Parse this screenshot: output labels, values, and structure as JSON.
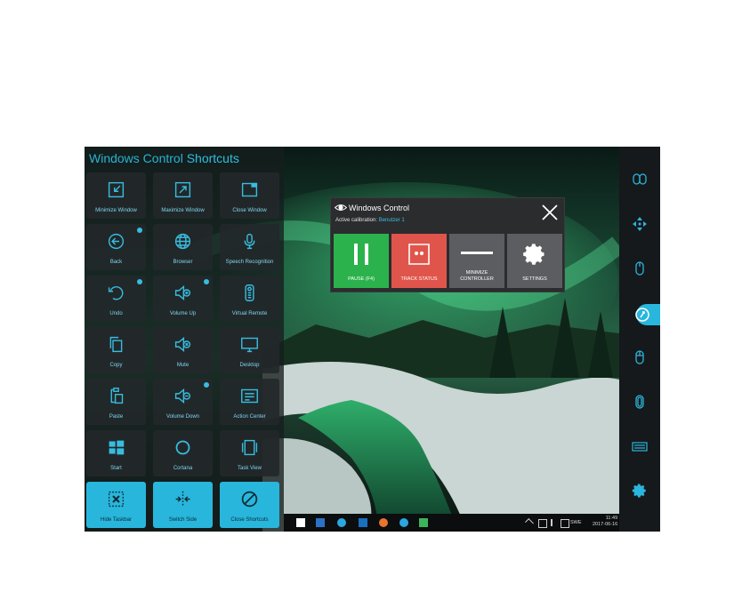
{
  "shortcuts_panel": {
    "title_part1": "Windows Control",
    "title_part2": "Shortcuts",
    "tiles": [
      {
        "label": "Minimize Window"
      },
      {
        "label": "Maximize Window"
      },
      {
        "label": "Close Window"
      },
      {
        "label": "Back"
      },
      {
        "label": "Browser"
      },
      {
        "label": "Speech Recognition"
      },
      {
        "label": "Undo"
      },
      {
        "label": "Volume Up"
      },
      {
        "label": "Virtual Remote"
      },
      {
        "label": "Copy"
      },
      {
        "label": "Mute"
      },
      {
        "label": "Desktop"
      },
      {
        "label": "Paste"
      },
      {
        "label": "Volume Down"
      },
      {
        "label": "Action Center"
      },
      {
        "label": "Start"
      },
      {
        "label": "Cortana"
      },
      {
        "label": "Task View"
      },
      {
        "label": "Hide Taskbar"
      },
      {
        "label": "Switch Side"
      },
      {
        "label": "Close Shortcuts"
      }
    ]
  },
  "dialog": {
    "title": "Windows Control",
    "calibration_label": "Active calibration:",
    "calibration_value": "Benutzer 1",
    "buttons": [
      {
        "label": "PAUSE (F4)",
        "color": "#2bb24c"
      },
      {
        "label": "TRACK STATUS",
        "color": "#e0554b"
      },
      {
        "label": "MINIMIZE CONTROLLER",
        "color": "#5c5d60"
      },
      {
        "label": "SETTINGS",
        "color": "#5c5d60"
      }
    ]
  },
  "taskbar": {
    "language": "SWE",
    "time": "11:49",
    "date": "2017-06-16"
  },
  "colors": {
    "accent": "#28b6dd",
    "panel": "#1c2426"
  }
}
